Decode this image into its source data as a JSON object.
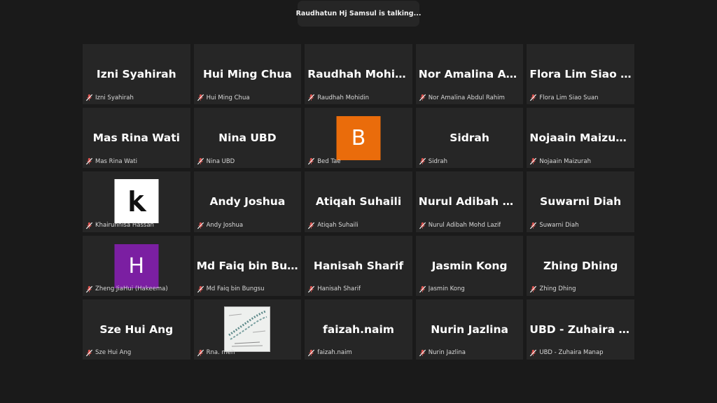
{
  "banner": {
    "text": "Raudhatun Hj Samsul is talking..."
  },
  "colors": {
    "tile_bg": "#262626",
    "page_bg": "#1a1a1a",
    "mic_muted": "#d9534f",
    "avatar_orange": "#ea6c0b",
    "avatar_purple": "#7b1fa2"
  },
  "tiles": [
    {
      "title": "Izni Syahirah",
      "footer": "Izni Syahirah"
    },
    {
      "title": "Hui Ming Chua",
      "footer": "Hui Ming Chua"
    },
    {
      "title": "Raudhah Mohidin",
      "footer": "Raudhah Mohidin"
    },
    {
      "title": "Nor Amalina Abdul Rahim",
      "footer": "Nor Amalina Abdul Rahim"
    },
    {
      "title": "Flora Lim Siao Suan",
      "footer": "Flora Lim Siao Suan"
    },
    {
      "title": "Mas Rina Wati",
      "footer": "Mas Rina Wati"
    },
    {
      "title": "Nina UBD",
      "footer": "Nina UBD"
    },
    {
      "avatar_letter": "B",
      "footer": "Bed Tae"
    },
    {
      "title": "Sidrah",
      "footer": "Sidrah"
    },
    {
      "title": "Nojaain Maizurah",
      "footer": "Nojaain Maizurah"
    },
    {
      "avatar_letter": "k",
      "footer": "Khairunnisa Hassan"
    },
    {
      "title": "Andy Joshua",
      "footer": "Andy Joshua"
    },
    {
      "title": "Atiqah Suhaili",
      "footer": "Atiqah Suhaili"
    },
    {
      "title": "Nurul Adibah Mohd Lazif",
      "footer": "Nurul Adibah Mohd Lazif"
    },
    {
      "title": "Suwarni Diah",
      "footer": "Suwarni Diah"
    },
    {
      "avatar_letter": "H",
      "footer": "Zheng JiaHui (Hakeema)"
    },
    {
      "title": "Md Faiq bin Bungsu",
      "footer": "Md Faiq bin Bungsu"
    },
    {
      "title": "Hanisah Sharif",
      "footer": "Hanisah Sharif"
    },
    {
      "title": "Jasmin Kong",
      "footer": "Jasmin Kong"
    },
    {
      "title": "Zhing Dhing",
      "footer": "Zhing Dhing"
    },
    {
      "title": "Sze Hui Ang",
      "footer": "Sze Hui Ang"
    },
    {
      "footer": "Rna. meh"
    },
    {
      "title": "faizah.naim",
      "footer": "faizah.naim"
    },
    {
      "title": "Nurin Jazlina",
      "footer": "Nurin Jazlina"
    },
    {
      "title": "UBD - Zuhaira Manap",
      "footer": "UBD - Zuhaira Manap"
    }
  ]
}
